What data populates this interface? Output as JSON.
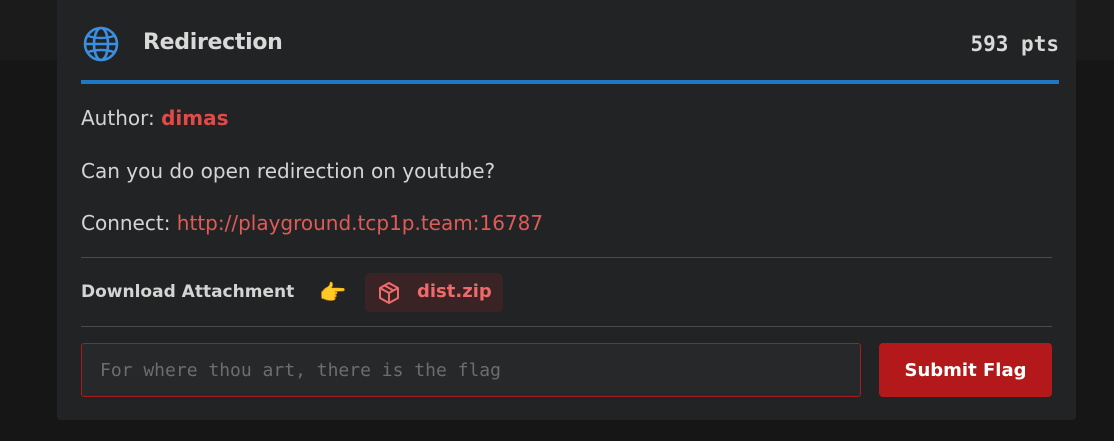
{
  "challenge": {
    "title": "Redirection",
    "points": "593 pts",
    "icon": "globe-icon",
    "author_label": "Author:",
    "author_name": "dimas",
    "description": "Can you do open redirection on youtube?",
    "connect_label": "Connect:",
    "connect_url": "http://playground.tcp1p.team:16787"
  },
  "attachment": {
    "label": "Download Attachment",
    "pointer_emoji": "👉",
    "file_name": "dist.zip",
    "icon": "package-icon"
  },
  "flag_form": {
    "placeholder": "For where thou art, there is the flag",
    "value": "",
    "submit_label": "Submit Flag"
  },
  "colors": {
    "accent_blue": "#1f78c4",
    "accent_red": "#b3191a",
    "author_red": "#e24a4a",
    "card_bg": "#222324"
  }
}
